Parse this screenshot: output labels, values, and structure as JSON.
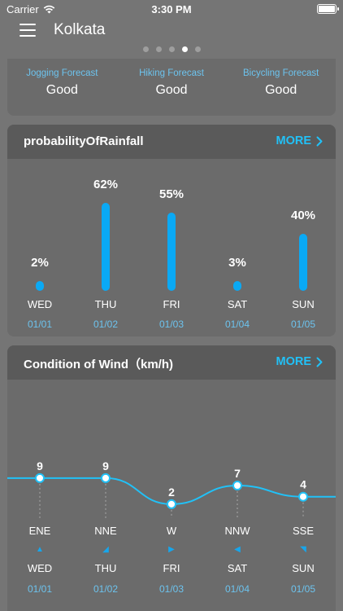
{
  "status": {
    "carrier": "Carrier",
    "time": "3:30 PM"
  },
  "nav": {
    "city": "Kolkata",
    "page_count": 5,
    "active_page": 3
  },
  "forecast": [
    {
      "label": "Jogging Forecast",
      "value": "Good"
    },
    {
      "label": "Hiking Forecast",
      "value": "Good"
    },
    {
      "label": "Bicycling Forecast",
      "value": "Good"
    }
  ],
  "rain": {
    "title": "probabilityOfRainfall",
    "more": "MORE",
    "days": [
      "WED",
      "THU",
      "FRI",
      "SAT",
      "SUN"
    ],
    "dates": [
      "01/01",
      "01/02",
      "01/03",
      "01/04",
      "01/05"
    ],
    "labels": [
      "2%",
      "62%",
      "55%",
      "3%",
      "40%"
    ]
  },
  "wind": {
    "title": "Condition of Wind（km/h)",
    "more": "MORE",
    "directions": [
      "ENE",
      "NNE",
      "W",
      "NNW",
      "SSE"
    ],
    "days": [
      "WED",
      "THU",
      "FRI",
      "SAT",
      "SUN"
    ],
    "dates": [
      "01/01",
      "01/02",
      "01/03",
      "01/04",
      "01/05"
    ],
    "arrow_icons": [
      "arrow-up-icon",
      "arrow-down-right-icon",
      "arrow-right-icon",
      "arrow-left-icon",
      "arrow-up-right-icon"
    ]
  },
  "chart_data": [
    {
      "type": "bar",
      "title": "probabilityOfRainfall",
      "categories": [
        "WED",
        "THU",
        "FRI",
        "SAT",
        "SUN"
      ],
      "values": [
        2,
        62,
        55,
        3,
        40
      ],
      "ylim": [
        0,
        100
      ],
      "color": "#0aa9f5"
    },
    {
      "type": "line",
      "title": "Condition of Wind（km/h)",
      "categories": [
        "WED",
        "THU",
        "FRI",
        "SAT",
        "SUN"
      ],
      "values": [
        9,
        9,
        2,
        7,
        4
      ],
      "ylim": [
        0,
        10
      ],
      "color": "#21c1f7"
    }
  ],
  "colors": {
    "accent": "#21c1f7",
    "date_text": "#6cc3ee",
    "background": "#757575",
    "card": "#6b6b6b"
  }
}
